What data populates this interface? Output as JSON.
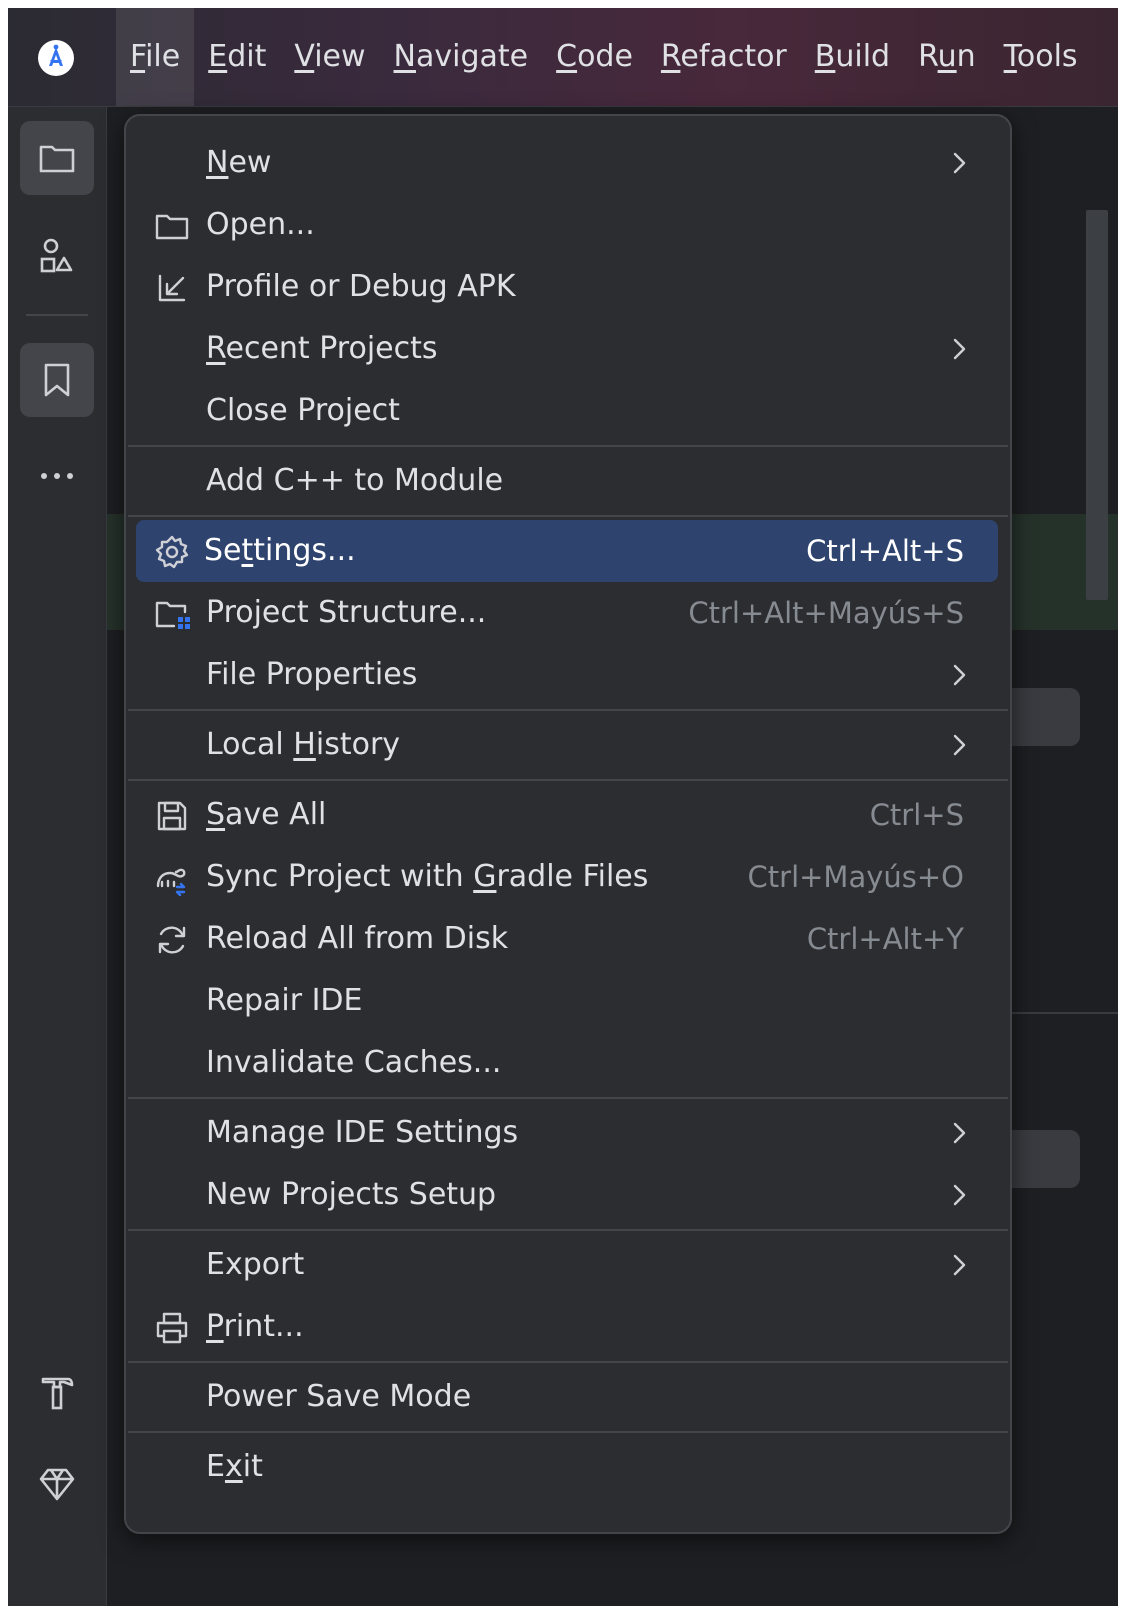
{
  "colors": {
    "ide_background": "#1e1f22",
    "menu_background": "#2b2d30",
    "highlight": "#2e436e",
    "text": "#dfe1e5",
    "shortcut_text": "#868a91",
    "accent_blue": "#3574f0"
  },
  "menubar": {
    "logo_icon": "android-studio-logo",
    "items": [
      {
        "label": "File",
        "mnemonic_index": 0
      },
      {
        "label": "Edit",
        "mnemonic_index": 0
      },
      {
        "label": "View",
        "mnemonic_index": 0
      },
      {
        "label": "Navigate",
        "mnemonic_index": 0
      },
      {
        "label": "Code",
        "mnemonic_index": 0
      },
      {
        "label": "Refactor",
        "mnemonic_index": 0
      },
      {
        "label": "Build",
        "mnemonic_index": 0
      },
      {
        "label": "Run",
        "mnemonic_index": 1
      },
      {
        "label": "Tools",
        "mnemonic_index": 0
      }
    ],
    "active": "File"
  },
  "toolstrip": {
    "items": [
      {
        "icon": "folder-icon",
        "active": true
      },
      {
        "icon": "shapes-icon",
        "active": false
      },
      {
        "icon": "bookmark-icon",
        "active": true
      },
      {
        "icon": "more-icon",
        "active": false
      },
      {
        "icon": "hammer-icon",
        "active": false
      },
      {
        "icon": "gem-icon",
        "active": false
      }
    ]
  },
  "file_menu": {
    "items": [
      {
        "label": "New",
        "mnemonic_index": 0,
        "icon": "",
        "shortcut": "",
        "submenu": true
      },
      {
        "label": "Open...",
        "mnemonic_index": -1,
        "icon": "folder-icon",
        "shortcut": "",
        "submenu": false
      },
      {
        "label": "Profile or Debug APK",
        "mnemonic_index": -1,
        "icon": "import-arrow-icon",
        "shortcut": "",
        "submenu": false
      },
      {
        "label": "Recent Projects",
        "mnemonic_index": 0,
        "icon": "",
        "shortcut": "",
        "submenu": true
      },
      {
        "label": "Close Project",
        "mnemonic_index": -1,
        "icon": "",
        "shortcut": "",
        "submenu": false
      },
      {
        "label": "Add C++ to Module",
        "mnemonic_index": -1,
        "icon": "",
        "shortcut": "",
        "submenu": false
      },
      {
        "label": "Settings...",
        "mnemonic_index": 2,
        "icon": "gear-icon",
        "shortcut": "Ctrl+Alt+S",
        "submenu": false,
        "highlighted": true
      },
      {
        "label": "Project Structure...",
        "mnemonic_index": -1,
        "icon": "project-structure-icon",
        "shortcut": "Ctrl+Alt+Mayús+S",
        "submenu": false
      },
      {
        "label": "File Properties",
        "mnemonic_index": -1,
        "icon": "",
        "shortcut": "",
        "submenu": true
      },
      {
        "label": "Local History",
        "mnemonic_index": 6,
        "icon": "",
        "shortcut": "",
        "submenu": true
      },
      {
        "label": "Save All",
        "mnemonic_index": 0,
        "icon": "save-icon",
        "shortcut": "Ctrl+S",
        "submenu": false
      },
      {
        "label": "Sync Project with Gradle Files",
        "mnemonic_index": 18,
        "icon": "gradle-sync-icon",
        "shortcut": "Ctrl+Mayús+O",
        "submenu": false
      },
      {
        "label": "Reload All from Disk",
        "mnemonic_index": -1,
        "icon": "reload-icon",
        "shortcut": "Ctrl+Alt+Y",
        "submenu": false
      },
      {
        "label": "Repair IDE",
        "mnemonic_index": -1,
        "icon": "",
        "shortcut": "",
        "submenu": false
      },
      {
        "label": "Invalidate Caches...",
        "mnemonic_index": -1,
        "icon": "",
        "shortcut": "",
        "submenu": false
      },
      {
        "label": "Manage IDE Settings",
        "mnemonic_index": -1,
        "icon": "",
        "shortcut": "",
        "submenu": true
      },
      {
        "label": "New Projects Setup",
        "mnemonic_index": -1,
        "icon": "",
        "shortcut": "",
        "submenu": true
      },
      {
        "label": "Export",
        "mnemonic_index": -1,
        "icon": "",
        "shortcut": "",
        "submenu": true
      },
      {
        "label": "Print...",
        "mnemonic_index": 0,
        "icon": "printer-icon",
        "shortcut": "",
        "submenu": false
      },
      {
        "label": "Power Save Mode",
        "mnemonic_index": -1,
        "icon": "",
        "shortcut": "",
        "submenu": false
      },
      {
        "label": "Exit",
        "mnemonic_index": 1,
        "icon": "",
        "shortcut": "",
        "submenu": false
      }
    ]
  }
}
